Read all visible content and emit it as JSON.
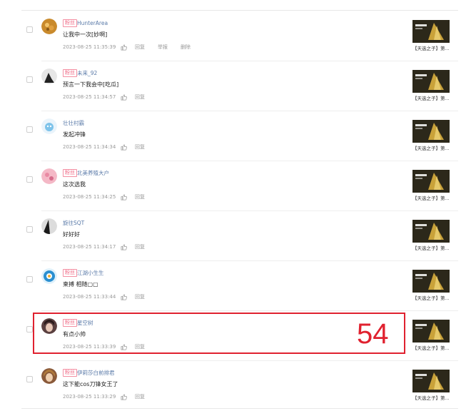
{
  "comments": [
    {
      "badge": "粉丝",
      "username": "HunterArea",
      "content": "让我中一次[妙啊]",
      "time": "2023-08-25 11:35:39",
      "actions": [
        "回复",
        "举报",
        "删除"
      ],
      "video_caption": "【天选之子】第..."
    },
    {
      "badge": "粉丝",
      "username": "未来_92",
      "content": "预言一下我会中[吃瓜]",
      "time": "2023-08-25 11:34:57",
      "actions": [
        "回复"
      ],
      "video_caption": "【天选之子】第..."
    },
    {
      "badge": "",
      "username": "壮壮村霸",
      "content": "发起冲锋",
      "time": "2023-08-25 11:34:34",
      "actions": [
        "回复"
      ],
      "video_caption": "【天选之子】第..."
    },
    {
      "badge": "粉丝",
      "username": "北美养殖大户",
      "content": "这次选我",
      "time": "2023-08-25 11:34:25",
      "actions": [
        "回复"
      ],
      "video_caption": "【天选之子】第..."
    },
    {
      "badge": "",
      "username": "旋往SQT",
      "content": "好好好",
      "time": "2023-08-25 11:34:17",
      "actions": [
        "回复"
      ],
      "video_caption": "【天选之子】第..."
    },
    {
      "badge": "粉丝",
      "username": "江湖小生生",
      "content": "柬搏 相随▢▢",
      "time": "2023-08-25 11:33:44",
      "actions": [
        "回复"
      ],
      "video_caption": "【天选之子】第..."
    },
    {
      "badge": "粉丝",
      "username": "星空树",
      "content": "有点小帅",
      "time": "2023-08-25 11:33:39",
      "actions": [
        "回复"
      ],
      "video_caption": "【天选之子】第..."
    },
    {
      "badge": "粉丝",
      "username": "伊莉莎白前排君",
      "content": "这下能cos刀锋女王了",
      "time": "2023-08-25 11:33:29",
      "actions": [
        "回复"
      ],
      "video_caption": "【天选之子】第..."
    }
  ],
  "annotation": {
    "label": "54",
    "color": "#e0212f"
  },
  "colors": {
    "badge": "#f06a86",
    "username": "#5a7aa8",
    "meta": "#999999"
  }
}
